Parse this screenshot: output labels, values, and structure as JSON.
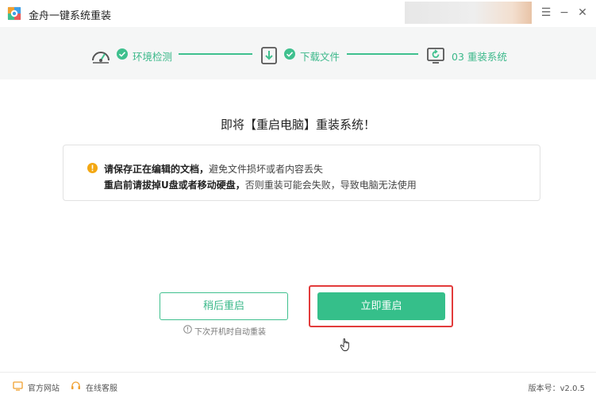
{
  "app": {
    "title": "金舟一键系统重装"
  },
  "window_controls": {
    "menu": "☰",
    "minimize": "−",
    "close": "✕"
  },
  "steps": [
    {
      "label": "环境检测",
      "state": "done",
      "icon": "gauge-icon"
    },
    {
      "label": "下载文件",
      "state": "done",
      "icon": "download-icon"
    },
    {
      "label": "03 重装系统",
      "state": "current",
      "icon": "reinstall-icon"
    }
  ],
  "main": {
    "heading": "即将【重启电脑】重装系统！",
    "notice": {
      "line1_bold": "请保存正在编辑的文档，",
      "line1_rest": "避免文件损坏或者内容丢失",
      "line2_bold": "重启前请拔掉U盘或者移动硬盘，",
      "line2_rest": "否则重装可能会失败，导致电脑无法使用"
    },
    "buttons": {
      "later": "稍后重启",
      "now": "立即重启"
    },
    "hint": "下次开机时自动重装"
  },
  "footer": {
    "website": "官方网站",
    "support": "在线客服",
    "version": "版本号：v2.0.5"
  },
  "colors": {
    "accent": "#35bf8a",
    "highlight": "#e23b3b",
    "warning": "#f3a712"
  }
}
